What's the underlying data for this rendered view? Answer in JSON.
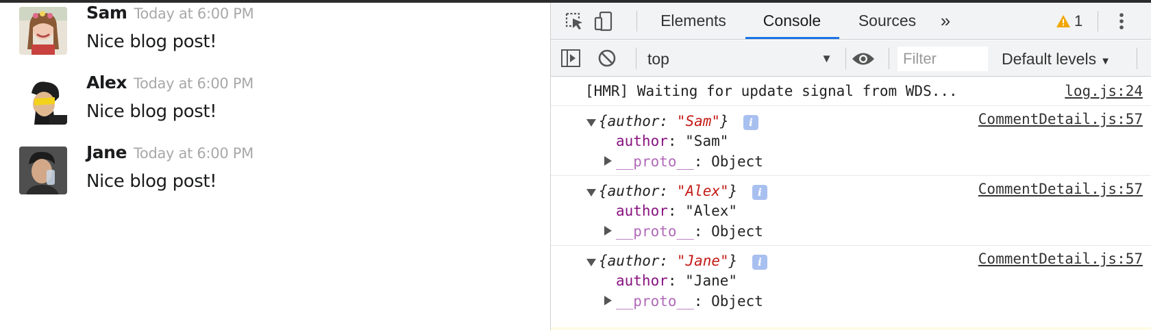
{
  "page": {
    "comments": [
      {
        "author": "Sam",
        "date": "Today at 6:00 PM",
        "text": "Nice blog post!"
      },
      {
        "author": "Alex",
        "date": "Today at 6:00 PM",
        "text": "Nice blog post!"
      },
      {
        "author": "Jane",
        "date": "Today at 6:00 PM",
        "text": "Nice blog post!"
      }
    ]
  },
  "devtools": {
    "tabs": {
      "elements": "Elements",
      "console": "Console",
      "sources": "Sources",
      "more": "»"
    },
    "active_tab": "Console",
    "warning_count": "1",
    "toolbar": {
      "context": "top",
      "filter_placeholder": "Filter",
      "levels": "Default levels"
    },
    "console": {
      "hmr_message": "[HMR] Waiting for update signal from WDS...",
      "hmr_source": "log.js:24",
      "entries": [
        {
          "summary_key": "author",
          "summary_value": "\"Sam\"",
          "prop_key": "author",
          "prop_value": "\"Sam\"",
          "proto_key": "__proto__",
          "proto_value": "Object",
          "source": "CommentDetail.js:57"
        },
        {
          "summary_key": "author",
          "summary_value": "\"Alex\"",
          "prop_key": "author",
          "prop_value": "\"Alex\"",
          "proto_key": "__proto__",
          "proto_value": "Object",
          "source": "CommentDetail.js:57"
        },
        {
          "summary_key": "author",
          "summary_value": "\"Jane\"",
          "prop_key": "author",
          "prop_value": "\"Jane\"",
          "proto_key": "__proto__",
          "proto_value": "Object",
          "source": "CommentDetail.js:57"
        }
      ]
    },
    "colors": {
      "accent": "#1a73e8",
      "warning": "#f2a600",
      "string": "#c41a16",
      "key": "#881280"
    }
  }
}
